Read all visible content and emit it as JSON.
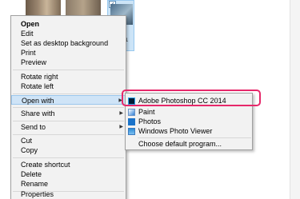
{
  "explorer": {
    "selected_file_name": "S0111_1 2.JPG",
    "checkbox_mark": "✓"
  },
  "context_menu": {
    "items": [
      {
        "label": "Open",
        "bold": true
      },
      {
        "label": "Edit"
      },
      {
        "label": "Set as desktop background"
      },
      {
        "label": "Print"
      },
      {
        "label": "Preview"
      },
      {
        "label": "Rotate right"
      },
      {
        "label": "Rotate left"
      },
      {
        "label": "Open with",
        "highlighted": true,
        "has_submenu": true
      },
      {
        "label": "Share with",
        "has_submenu": true
      },
      {
        "label": "Send to",
        "has_submenu": true
      },
      {
        "label": "Cut"
      },
      {
        "label": "Copy"
      },
      {
        "label": "Create shortcut"
      },
      {
        "label": "Delete"
      },
      {
        "label": "Rename"
      },
      {
        "label": "Properties"
      }
    ],
    "submenu_arrow": "▶"
  },
  "open_with_submenu": {
    "items": [
      {
        "label": "Adobe Photoshop CC 2014",
        "icon": "photoshop-icon"
      },
      {
        "label": "Paint",
        "icon": "paint-icon"
      },
      {
        "label": "Photos",
        "icon": "photos-icon"
      },
      {
        "label": "Windows Photo Viewer",
        "icon": "photo-viewer-icon"
      },
      {
        "label": "Choose default program..."
      }
    ]
  },
  "colors": {
    "highlight_ring": "#e6286a",
    "hover_bg": "#cfe4f7",
    "menu_bg": "#f2f2f2"
  }
}
